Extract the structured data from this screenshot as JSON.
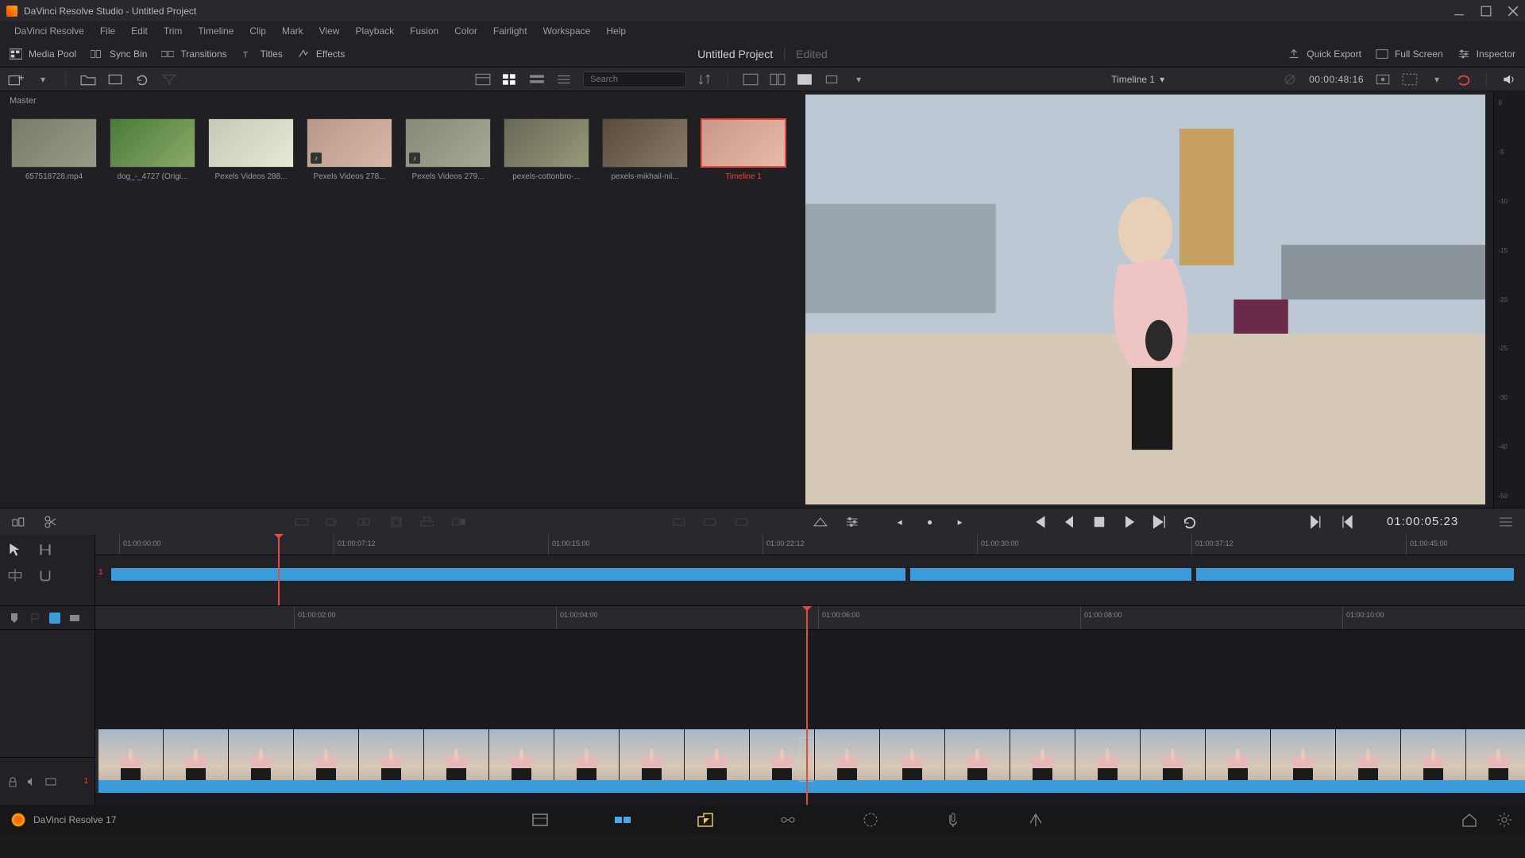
{
  "titlebar": {
    "title": "DaVinci Resolve Studio - Untitled Project"
  },
  "menus": [
    "DaVinci Resolve",
    "File",
    "Edit",
    "Trim",
    "Timeline",
    "Clip",
    "Mark",
    "View",
    "Playback",
    "Fusion",
    "Color",
    "Fairlight",
    "Workspace",
    "Help"
  ],
  "toolbar": {
    "media_pool": "Media Pool",
    "sync_bin": "Sync Bin",
    "transitions": "Transitions",
    "titles": "Titles",
    "effects": "Effects",
    "quick_export": "Quick Export",
    "full_screen": "Full Screen",
    "inspector": "Inspector"
  },
  "project": {
    "name": "Untitled Project",
    "status": "Edited"
  },
  "subtoolbar": {
    "search_placeholder": "Search",
    "timeline_name": "Timeline 1",
    "source_tc": "00:00:48:16"
  },
  "media": {
    "bin": "Master",
    "clips": [
      {
        "label": "657518728.mp4"
      },
      {
        "label": "dog_-_4727 (Origi..."
      },
      {
        "label": "Pexels Videos 288..."
      },
      {
        "label": "Pexels Videos 278..."
      },
      {
        "label": "Pexels Videos 279..."
      },
      {
        "label": "pexels-cottonbro-..."
      },
      {
        "label": "pexels-mikhail-nil..."
      },
      {
        "label": "Timeline 1"
      }
    ]
  },
  "meter": {
    "marks": [
      "0",
      "-5",
      "-10",
      "-15",
      "-20",
      "-25",
      "-30",
      "-40",
      "-50"
    ]
  },
  "transport": {
    "record_tc": "01:00:05:23"
  },
  "mini_ruler": [
    "01:00:00:00",
    "01:00:07:12",
    "01:00:15:00",
    "01:00:22:12",
    "01:00:30:00",
    "01:00:37:12",
    "01:00:45:00"
  ],
  "detail_ruler": [
    "01:00:02:00",
    "01:00:04:00",
    "01:00:06:00",
    "01:00:08:00",
    "01:00:10:00"
  ],
  "footer": {
    "app": "DaVinci Resolve 17"
  }
}
